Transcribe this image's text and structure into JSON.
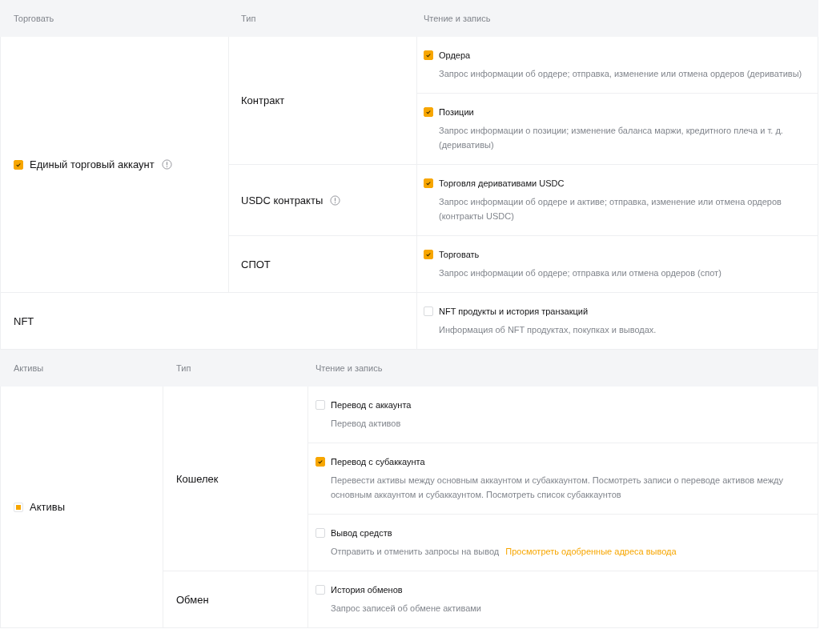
{
  "sections": [
    {
      "columns": [
        "Торговать",
        "Тип",
        "Чтение и запись"
      ],
      "groups": [
        {
          "label": "Единый торговый аккаунт",
          "checked": true,
          "info_icon": true,
          "types": [
            {
              "label": "Контракт",
              "permissions": [
                {
                  "label": "Ордера",
                  "checked": true,
                  "description": "Запрос информации об ордере; отправка, изменение или отмена ордеров (деривативы)"
                },
                {
                  "label": "Позиции",
                  "checked": true,
                  "description": "Запрос информации о позиции; изменение баланса маржи, кредитного плеча и т. д. (деривативы)"
                }
              ]
            },
            {
              "label": "USDC контракты",
              "info_icon": true,
              "permissions": [
                {
                  "label": "Торговля деривативами USDC",
                  "checked": true,
                  "description": "Запрос информации об ордере и активе; отправка, изменение или отмена ордеров (контракты USDC)"
                }
              ]
            },
            {
              "label": "СПОТ",
              "permissions": [
                {
                  "label": "Торговать",
                  "checked": true,
                  "description": "Запрос информации об ордере; отправка или отмена ордеров (спот)"
                }
              ]
            }
          ]
        },
        {
          "label": "NFT",
          "permissions": [
            {
              "label": "NFT продукты и история транзакций",
              "checked": false,
              "description": "Информация об NFT продуктах, покупках и выводах."
            }
          ]
        }
      ]
    },
    {
      "columns": [
        "Активы",
        "Тип",
        "Чтение и запись"
      ],
      "groups": [
        {
          "label": "Активы",
          "indeterminate": true,
          "types": [
            {
              "label": "Кошелек",
              "permissions": [
                {
                  "label": "Перевод с аккаунта",
                  "checked": false,
                  "description": "Перевод активов"
                },
                {
                  "label": "Перевод с субаккаунта",
                  "checked": true,
                  "description": "Перевести активы между основным аккаунтом и субаккаунтом. Посмотреть записи о переводе активов между основным аккаунтом и субаккаунтом. Посмотреть список субаккаунтов"
                },
                {
                  "label": "Вывод средств",
                  "checked": false,
                  "description": "Отправить и отменить запросы на вывод",
                  "link": "Просмотреть одобренные адреса вывода"
                }
              ]
            },
            {
              "label": "Обмен",
              "permissions": [
                {
                  "label": "История обменов",
                  "checked": false,
                  "description": "Запрос записей об обмене активами"
                }
              ]
            }
          ]
        }
      ]
    }
  ]
}
